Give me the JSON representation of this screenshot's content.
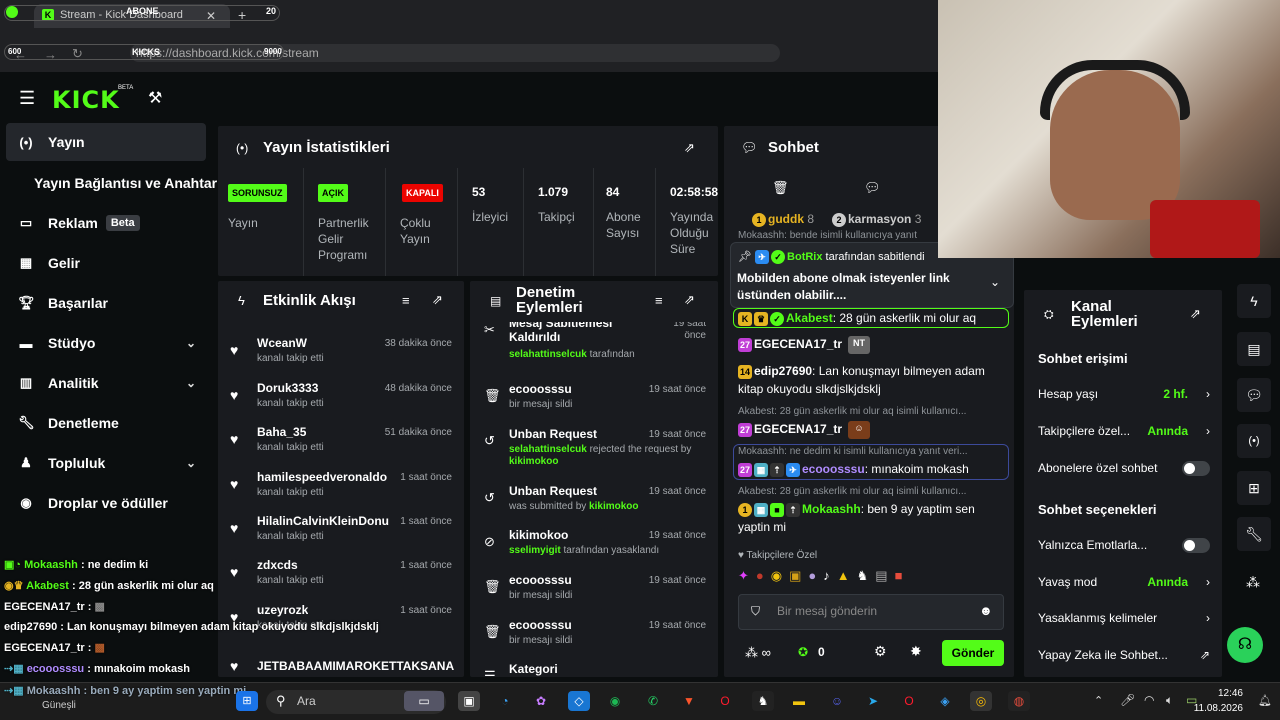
{
  "browser": {
    "tab_title": "Stream - Kick Dashboard",
    "url": "https://dashboard.kick.com/stream",
    "overlay_abone": "ABONE",
    "overlay_20": "20",
    "overlay_kicks": "KICKS",
    "overlay_600": "600",
    "overlay_9000": "9000"
  },
  "header": {
    "logo": "KICK",
    "beta": "BETA"
  },
  "sidebar": {
    "items": [
      {
        "label": "Yayın",
        "icon": "broadcast-icon"
      },
      {
        "label": "Yayın Bağlantısı ve Anahtarı",
        "icon": ""
      },
      {
        "label": "Reklam",
        "icon": "ad-icon",
        "badge": "Beta"
      },
      {
        "label": "Gelir",
        "icon": "chart-icon"
      },
      {
        "label": "Başarılar",
        "icon": "trophy-icon"
      },
      {
        "label": "Stüdyo",
        "icon": "studio-icon"
      },
      {
        "label": "Analitik",
        "icon": "analytics-icon"
      },
      {
        "label": "Denetleme",
        "icon": "wrench-icon"
      },
      {
        "label": "Topluluk",
        "icon": "community-icon"
      },
      {
        "label": "Droplar ve ödüller",
        "icon": "gift-icon"
      }
    ]
  },
  "stats": {
    "title": "Yayın İstatistikleri",
    "cols": [
      {
        "badge": "SORUNSUZ",
        "badge_color": "#53fc18",
        "label": "Yayın"
      },
      {
        "badge": "AÇIK",
        "badge_color": "#53fc18",
        "label": "Partnerlik Gelir Programı"
      },
      {
        "badge": "KAPALI",
        "badge_color": "#eb0400",
        "label": "Çoklu Yayın"
      },
      {
        "value": "53",
        "label": "İzleyici"
      },
      {
        "value": "1.079",
        "label": "Takipçi"
      },
      {
        "value": "84",
        "label": "Abone Sayısı"
      },
      {
        "value": "02:58:58",
        "label": "Yayında Olduğu Süre"
      }
    ]
  },
  "activity": {
    "title": "Etkinlik Akışı",
    "items": [
      {
        "name": "WceanW",
        "sub": "kanalı takip etti",
        "time": "38 dakika önce"
      },
      {
        "name": "Doruk3333",
        "sub": "kanalı takip etti",
        "time": "48 dakika önce"
      },
      {
        "name": "Baha_35",
        "sub": "kanalı takip etti",
        "time": "51 dakika önce"
      },
      {
        "name": "hamilespeedveronaldo",
        "sub": "kanalı takip etti",
        "time": "1 saat önce"
      },
      {
        "name": "HilalinCalvinKleinDonu",
        "sub": "kanalı takip etti",
        "time": "1 saat önce"
      },
      {
        "name": "zdxcds",
        "sub": "kanalı takip etti",
        "time": "1 saat önce"
      },
      {
        "name": "uzeyrozk",
        "sub": "kanalı takip etti",
        "time": "1 saat önce"
      },
      {
        "name": "JETBABAAMIMAROKETTAKSANA",
        "sub": "",
        "time": ""
      }
    ]
  },
  "moderation": {
    "title_1": "Denetim",
    "title_2": "Eylemleri",
    "items": [
      {
        "name": "Mesaj Sabitlemesi Kaldırıldı",
        "sub_user": "selahattinselcuk",
        "sub_text": " tarafından",
        "time": "19 saat önce"
      },
      {
        "name": "ecooosssu",
        "sub_user": "",
        "sub_text": "bir mesajı sildi",
        "time": "19 saat önce"
      },
      {
        "name": "Unban Request",
        "sub_user": "selahattinselcuk",
        "sub_text": " rejected the request by ",
        "sub_user2": "kikimokoo",
        "time": "19 saat önce"
      },
      {
        "name": "Unban Request",
        "sub_user": "",
        "sub_text": "was submitted by ",
        "sub_user2": "kikimokoo",
        "time": "19 saat önce"
      },
      {
        "name": "kikimokoo",
        "sub_user": "sselimyigit",
        "sub_text": " tarafından yasaklandı",
        "time": "19 saat önce"
      },
      {
        "name": "ecooosssu",
        "sub_user": "",
        "sub_text": "bir mesajı sildi",
        "time": "19 saat önce"
      },
      {
        "name": "ecooosssu",
        "sub_user": "",
        "sub_text": "bir mesajı sildi",
        "time": "19 saat önce"
      },
      {
        "name": "Kategori",
        "sub_user": "",
        "sub_text": "",
        "time": ""
      }
    ]
  },
  "chat": {
    "title": "Sohbet",
    "top_users": [
      {
        "rank": "1",
        "name": "guddk",
        "count": "8"
      },
      {
        "rank": "2",
        "name": "karmasyon",
        "count": "3"
      }
    ],
    "faded_line": "Mokaashh: bende isimli kullanıcıya yanıt",
    "pinned_by": "BotRix",
    "pinned_suffix": "tarafından sabitlendi",
    "pinned_text": "Mobilden abone olmak isteyenler link üstünden olabilir....",
    "messages": [
      {
        "type": "msg",
        "user": "Akabest",
        "text": "28 gün askerlik mi olur aq"
      },
      {
        "type": "msg",
        "badge": "27",
        "user": "EGECENA17_tr",
        "text": ""
      },
      {
        "type": "msg",
        "badge": "14",
        "user": "edip27690",
        "text": "Lan konuşmayı bilmeyen adam kitap okuyodu slkdjslkjdsklj"
      },
      {
        "type": "reply",
        "text": "Akabest: 28 gün askerlik mi olur aq isimli kullanıcı..."
      },
      {
        "type": "msg",
        "badge": "27",
        "user": "EGECENA17_tr",
        "text": ""
      },
      {
        "type": "reply",
        "text": "Mokaashh: ne dedim ki isimli kullanıcıya yanıt veri..."
      },
      {
        "type": "msg",
        "badge": "27",
        "user": "ecooosssu",
        "text": "mınakoim mokash"
      },
      {
        "type": "reply",
        "text": "Akabest: 28 gün askerlik mi olur aq isimli kullanıcı..."
      },
      {
        "type": "msg",
        "badge": "1",
        "user": "Mokaashh",
        "text": "ben 9 ay yaptim sen yaptin mi"
      }
    ],
    "emote_header": "Takipçilere Özel",
    "placeholder": "Bir mesaj gönderin",
    "points": "0",
    "send": "Gönder"
  },
  "channel_actions": {
    "title_1": "Kanal",
    "title_2": "Eylemleri",
    "section_1": "Sohbet erişimi",
    "rows_1": [
      {
        "label": "Hesap yaşı",
        "value": "2 hf."
      },
      {
        "label": "Takipçilere özel...",
        "value": "Anında"
      },
      {
        "label": "Abonelere özel sohbet",
        "value": ""
      }
    ],
    "section_2": "Sohbet seçenekleri",
    "rows_2": [
      {
        "label": "Yalnızca Emotlarla...",
        "value": ""
      },
      {
        "label": "Yavaş mod",
        "value": "Anında"
      },
      {
        "label": "Yasaklanmış kelimeler",
        "value": ""
      },
      {
        "label": "Yapay Zeka ile Sohbet...",
        "value": ""
      }
    ]
  },
  "overlay_chat": [
    {
      "user": "Mokaashh",
      "text": "ne dedim ki"
    },
    {
      "user": "Akabest",
      "text": "28 gün askerlik mi olur aq"
    },
    {
      "user": "EGECENA17_tr",
      "text": ""
    },
    {
      "user": "edip27690",
      "text": "Lan konuşmayı bilmeyen adam kitap okuyodu slkdjslkjdsklj"
    },
    {
      "user": "EGECENA17_tr",
      "text": ""
    },
    {
      "user": "ecooosssu",
      "text": "mınakoim mokash"
    },
    {
      "user": "Mokaashh",
      "text": "ben 9 ay yaptim sen yaptin mi"
    }
  ],
  "taskbar": {
    "weather": "Güneşli",
    "search": "Ara",
    "time": "12:46",
    "date": "11.08.2026"
  },
  "colors": {
    "accent": "#53fc18",
    "danger": "#eb0400",
    "panel": "#191b1f"
  }
}
